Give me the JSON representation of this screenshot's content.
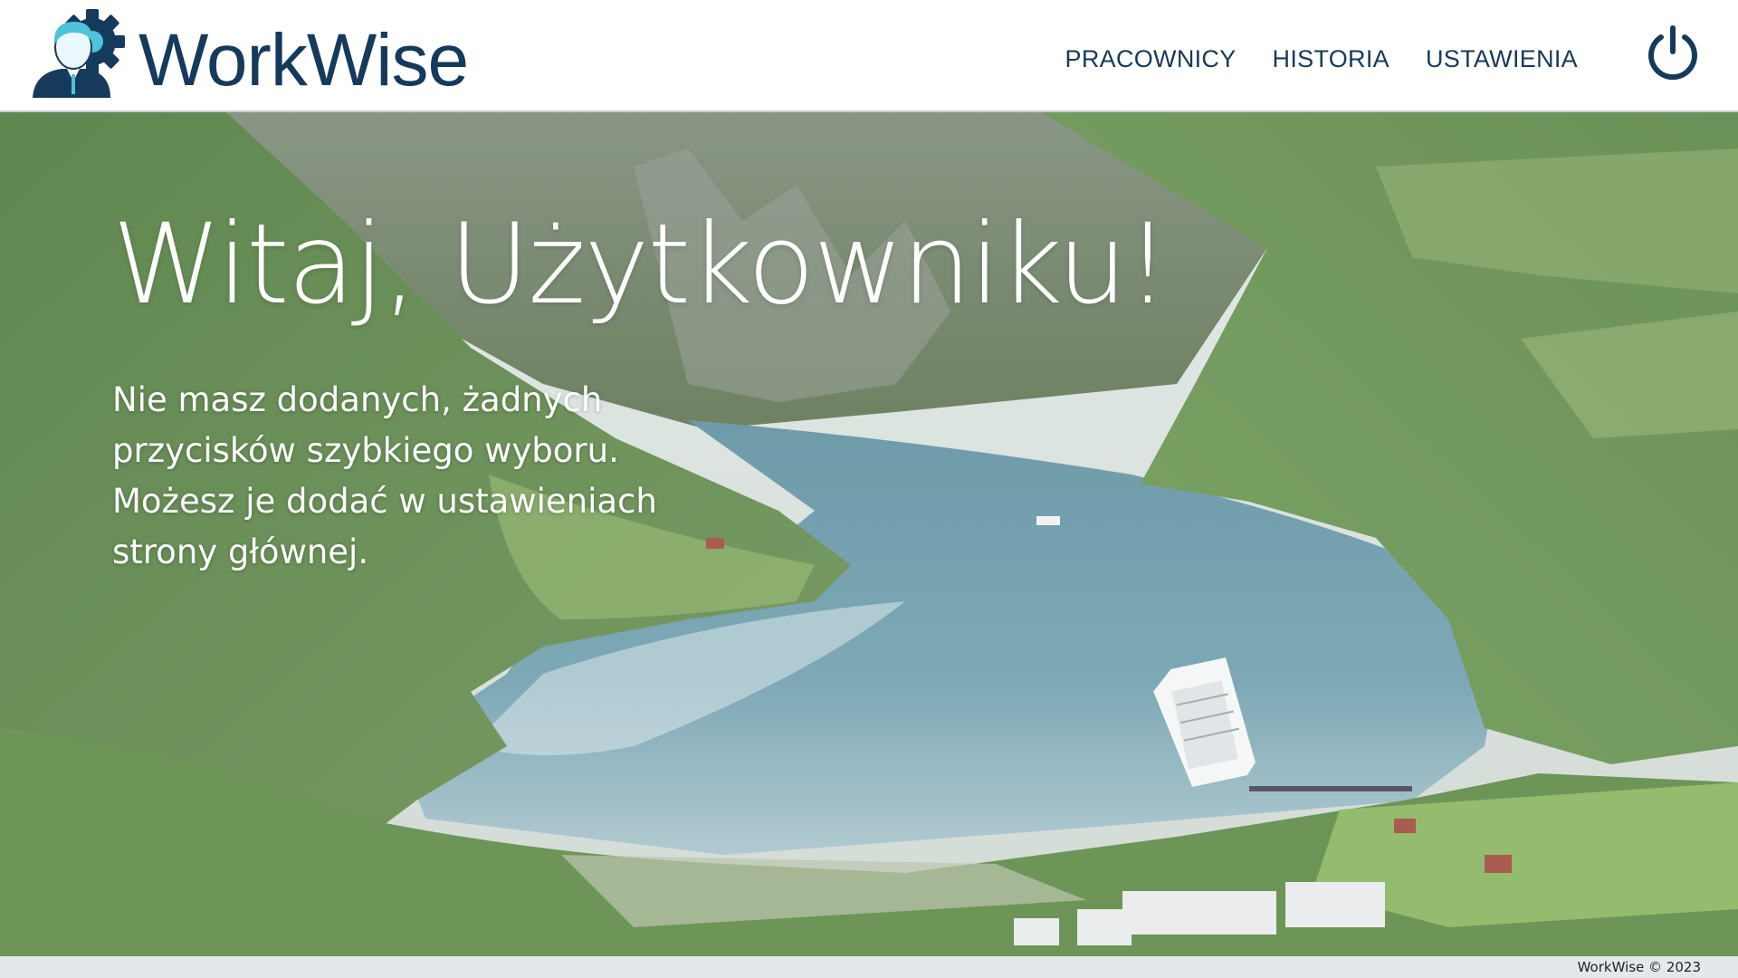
{
  "app": {
    "brand": "WorkWise"
  },
  "nav": {
    "items": [
      {
        "label": "PRACOWNICY"
      },
      {
        "label": "HISTORIA"
      },
      {
        "label": "USTAWIENIA"
      }
    ],
    "power_icon": "power-icon"
  },
  "hero": {
    "title": "Witaj, Użytkowniku!",
    "message": "Nie masz dodanych, żadnych przycisków szybkiego wyboru. Możesz je dodać w ustawieniach strony głównej."
  },
  "footer": {
    "text": "WorkWise © 2023"
  },
  "colors": {
    "brand": "#163a5c",
    "accent": "#4fc3d9"
  }
}
